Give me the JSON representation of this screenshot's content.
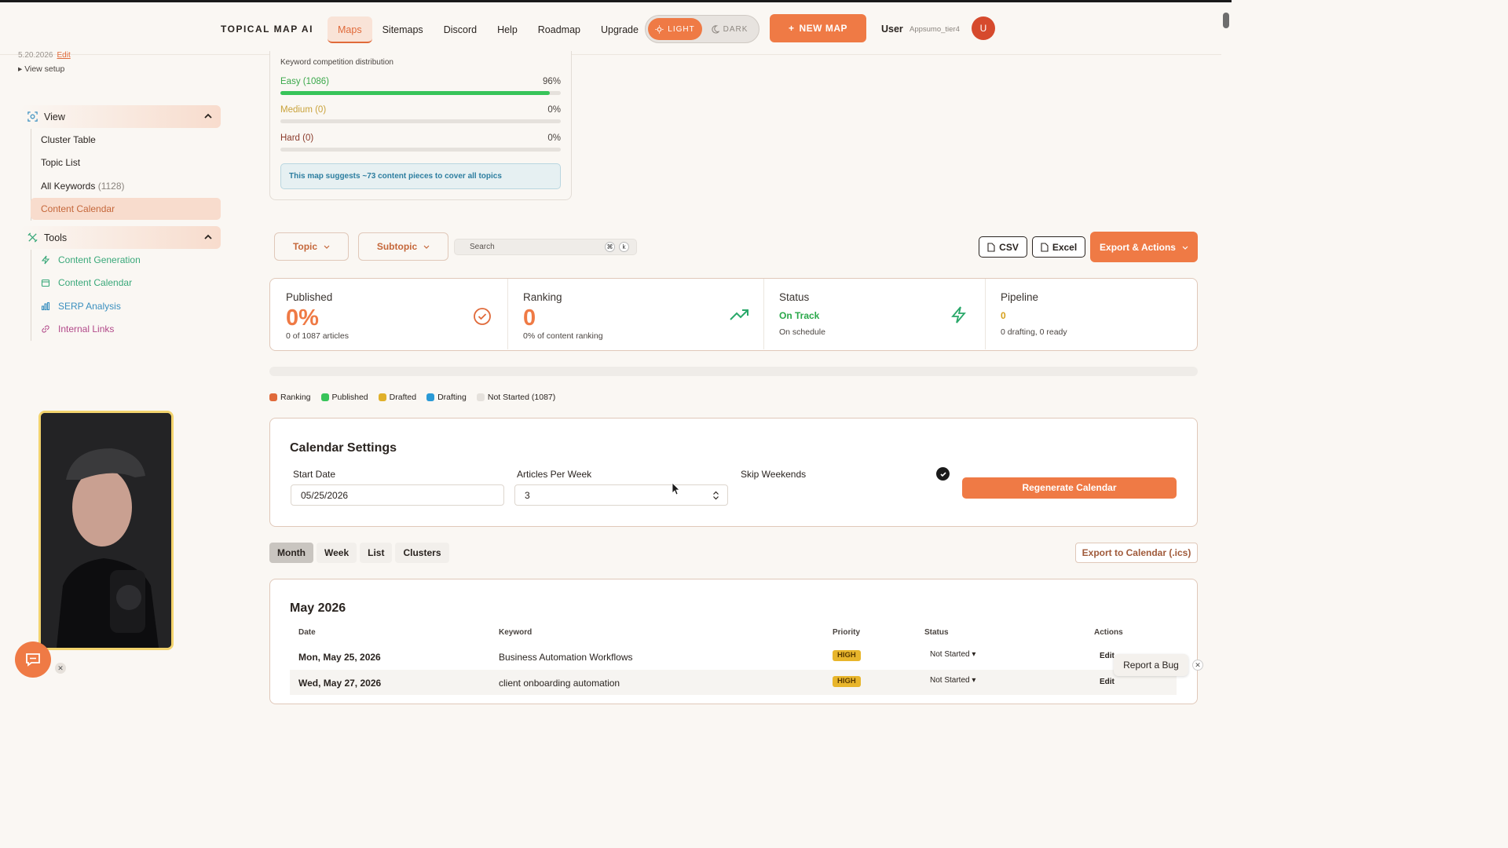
{
  "header": {
    "logo": "TOPICAL MAP AI",
    "nav": [
      "Maps",
      "Sitemaps",
      "Discord",
      "Help",
      "Roadmap",
      "Upgrade"
    ],
    "active_nav": "Maps",
    "theme_light": "LIGHT",
    "theme_dark": "DARK",
    "new_map": "NEW MAP",
    "user_label": "User",
    "user_name": "Appsumo_tier4",
    "avatar_initial": "U"
  },
  "sidebar": {
    "date": "5.20.2026",
    "date_edit": "Edit",
    "view_setup": "▸ View setup",
    "view_section": "View",
    "view_items": [
      {
        "label": "Cluster Table",
        "count": ""
      },
      {
        "label": "Topic List",
        "count": ""
      },
      {
        "label": "All Keywords",
        "count": "(1128)"
      },
      {
        "label": "Content Calendar",
        "count": ""
      }
    ],
    "tools_section": "Tools",
    "tool_items": [
      {
        "label": "Content Generation",
        "color": "#3aa87a"
      },
      {
        "label": "Content Calendar",
        "color": "#3aa87a"
      },
      {
        "label": "SERP Analysis",
        "color": "#3a8fbf"
      },
      {
        "label": "Internal Links",
        "color": "#b24a8a"
      }
    ]
  },
  "distribution": {
    "title": "Keyword competition distribution",
    "rows": [
      {
        "label": "Easy (1086)",
        "pct": "96%",
        "color": "#3aa84a",
        "fill": 0.96
      },
      {
        "label": "Medium (0)",
        "pct": "0%",
        "color": "#c9a23a",
        "fill": 0
      },
      {
        "label": "Hard (0)",
        "pct": "0%",
        "color": "#8a3a2a",
        "fill": 0
      }
    ],
    "note": "This map suggests ~73 content pieces to cover all topics"
  },
  "filters": {
    "topic": "Topic",
    "subtopic": "Subtopic",
    "search_placeholder": "Search",
    "kbd_cmd": "⌘",
    "kbd_k": "k",
    "csv": "CSV",
    "excel": "Excel",
    "export": "Export & Actions"
  },
  "stats": {
    "published": {
      "title": "Published",
      "value": "0%",
      "sub": "0 of 1087 articles"
    },
    "ranking": {
      "title": "Ranking",
      "value": "0",
      "sub": "0% of content ranking"
    },
    "status": {
      "title": "Status",
      "value": "On Track",
      "sub": "On schedule"
    },
    "pipeline": {
      "title": "Pipeline",
      "value": "0",
      "sub": "0 drafting, 0 ready"
    }
  },
  "legend": [
    {
      "label": "Ranking",
      "color": "#e06a3a"
    },
    {
      "label": "Published",
      "color": "#38c45a"
    },
    {
      "label": "Drafted",
      "color": "#e0b02a"
    },
    {
      "label": "Drafting",
      "color": "#2a9ad6"
    },
    {
      "label": "Not Started (1087)",
      "color": "#e5e1dc"
    }
  ],
  "calendar_settings": {
    "title": "Calendar Settings",
    "start_date_label": "Start Date",
    "start_date": "05/25/2026",
    "articles_label": "Articles Per Week",
    "articles": "3",
    "skip_weekends_label": "Skip Weekends",
    "regenerate": "Regenerate Calendar"
  },
  "view_tabs": [
    "Month",
    "Week",
    "List",
    "Clusters"
  ],
  "active_tab": "Month",
  "export_ics": "Export to Calendar (.ics)",
  "calendar": {
    "month": "May 2026",
    "headers": [
      "Date",
      "Keyword",
      "Priority",
      "Status",
      "Actions"
    ],
    "rows": [
      {
        "date": "Mon, May 25, 2026",
        "keyword": "Business Automation Workflows",
        "priority": "HIGH",
        "status": "Not Started",
        "action": "Edit"
      },
      {
        "date": "Wed, May 27, 2026",
        "keyword": "client onboarding automation",
        "priority": "HIGH",
        "status": "Not Started",
        "action": "Edit"
      }
    ]
  },
  "report_bug": "Report a Bug"
}
